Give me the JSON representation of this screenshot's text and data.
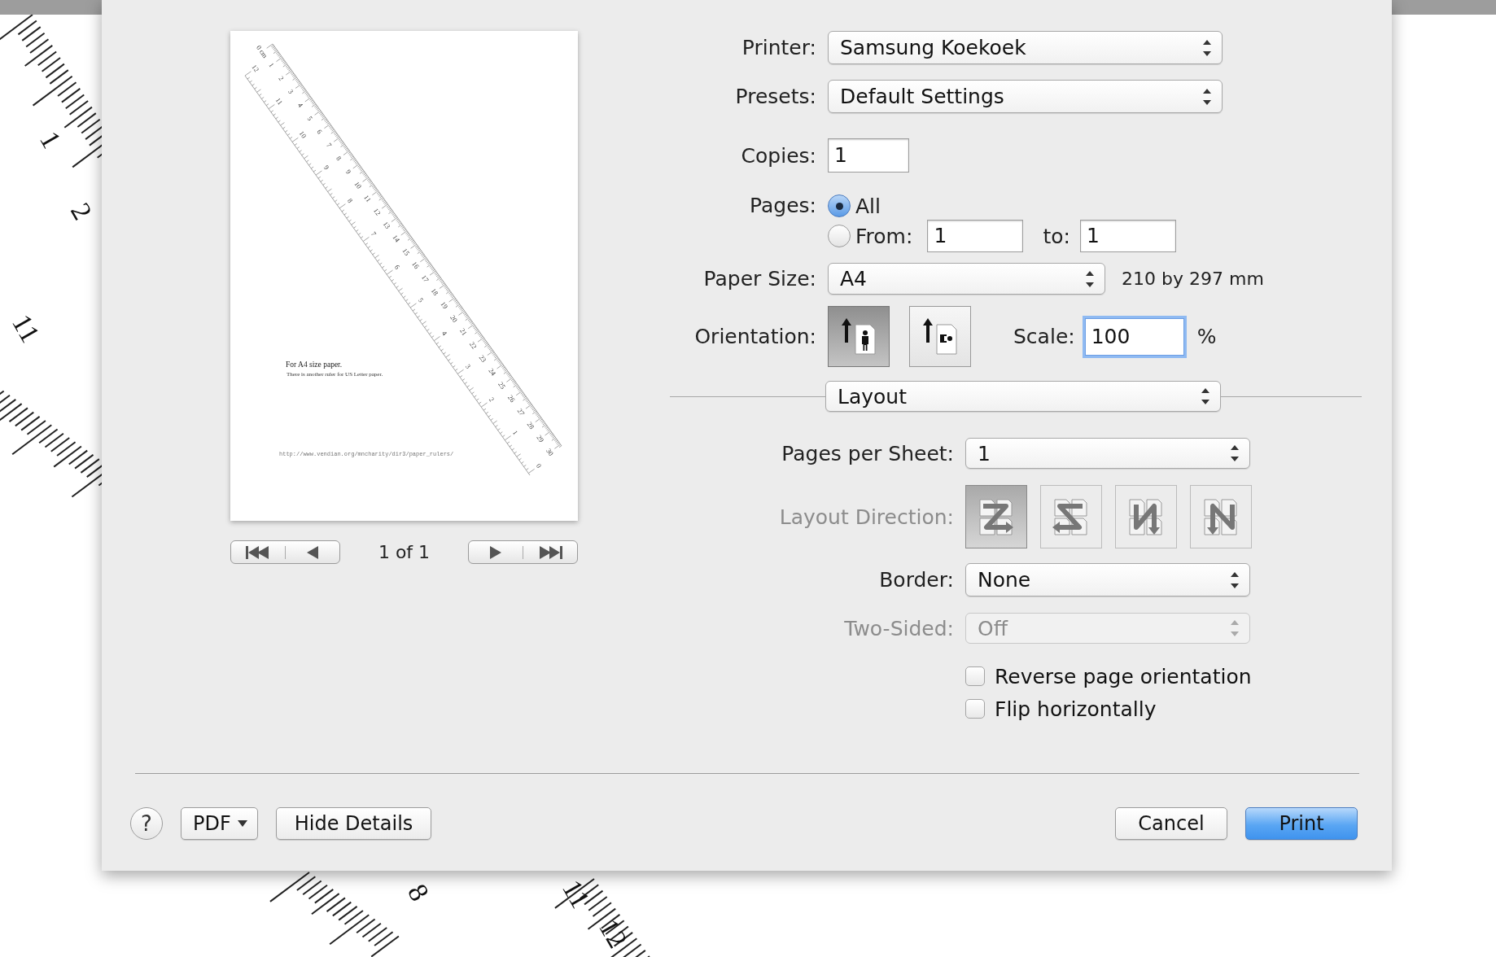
{
  "background": {
    "ruler_labels": [
      "1",
      "2",
      "11",
      "8",
      "11",
      "12"
    ]
  },
  "preview": {
    "page": {
      "heading": "For A4 size paper.",
      "subheading": "There is another ruler for US Letter paper.",
      "url": "http://www.vendian.org/mncharity/dir3/paper_rulers/",
      "cm_labels": [
        "0 cm",
        "1",
        "2",
        "3",
        "4",
        "5",
        "6",
        "7",
        "8",
        "9",
        "10",
        "11",
        "12",
        "13",
        "14",
        "15",
        "16",
        "17",
        "18",
        "19",
        "20",
        "21",
        "22",
        "23",
        "24",
        "25",
        "26",
        "27",
        "28",
        "29",
        "30"
      ],
      "inch_labels": [
        "12",
        "11",
        "10",
        "9",
        "8",
        "7",
        "6",
        "5",
        "4",
        "3",
        "2",
        "1",
        "0"
      ]
    },
    "page_indicator": "1 of 1"
  },
  "settings": [
    {
      "kind": "popup",
      "label": "Printer:",
      "value": "Samsung Koekoek"
    },
    {
      "kind": "popup",
      "label": "Presets:",
      "value": "Default Settings"
    },
    {
      "kind": "field",
      "label": "Copies:",
      "value": "1"
    },
    {
      "kind": "pages",
      "label": "Pages:",
      "options": [
        {
          "label": "All",
          "selected": true
        },
        {
          "label": "From:",
          "selected": false
        }
      ],
      "from": "1",
      "to_label": "to:",
      "to": "1"
    },
    {
      "kind": "popup",
      "label": "Paper Size:",
      "value": "A4",
      "note": "210 by 297 mm"
    },
    {
      "kind": "orientation",
      "label": "Orientation:",
      "options": [
        {
          "kind": "portrait",
          "selected": true
        },
        {
          "kind": "landscape",
          "selected": false
        }
      ],
      "scale_label": "Scale:",
      "scale": "100",
      "scale_focused": true,
      "scale_unit": "%"
    }
  ],
  "section_popup": {
    "value": "Layout"
  },
  "layout": [
    {
      "kind": "popup",
      "label": "Pages per Sheet:",
      "value": "1",
      "disabled": false
    },
    {
      "kind": "direction",
      "label": "Layout Direction:",
      "disabled": true,
      "options": [
        {
          "kind": "z",
          "selected": true
        },
        {
          "kind": "s",
          "selected": false
        },
        {
          "kind": "n-reverse",
          "selected": false
        },
        {
          "kind": "n",
          "selected": false
        }
      ]
    },
    {
      "kind": "popup",
      "label": "Border:",
      "value": "None",
      "disabled": false
    },
    {
      "kind": "popup",
      "label": "Two-Sided:",
      "value": "Off",
      "disabled": true
    },
    {
      "kind": "checkbox",
      "label": "Reverse page orientation",
      "checked": false
    },
    {
      "kind": "checkbox",
      "label": "Flip horizontally",
      "checked": false
    }
  ],
  "footer": {
    "left": [
      {
        "kind": "help",
        "label": "?"
      },
      {
        "kind": "menu",
        "label": "PDF"
      },
      {
        "kind": "plain",
        "label": "Hide Details"
      }
    ],
    "right": [
      {
        "kind": "plain",
        "label": "Cancel"
      },
      {
        "kind": "default",
        "label": "Print"
      }
    ]
  }
}
